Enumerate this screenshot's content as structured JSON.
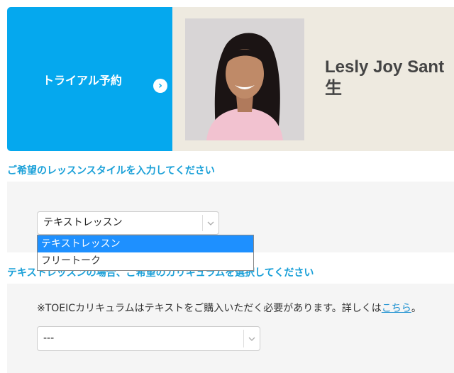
{
  "trial": {
    "label": "トライアル予約",
    "arrow": "›"
  },
  "teacher": {
    "name_line1": "Lesly Joy Sant",
    "name_line2": "生"
  },
  "lesson_style": {
    "heading": "ご希望のレッスンスタイルを入力してください",
    "selected": "テキストレッスン",
    "options": [
      "テキストレッスン",
      "フリートーク"
    ]
  },
  "curriculum": {
    "heading": "テキストレッスンの場合、ご希望のカリキュラムを選択してください",
    "note_text": "※TOEICカリキュラムはテキストをご購入いただく必要があります。詳しくは",
    "note_link": "こちら",
    "note_end": "。",
    "selected": "---"
  },
  "colors": {
    "accent": "#05a8ee",
    "heading": "#1aa0d8",
    "highlight": "#1e90ff"
  }
}
